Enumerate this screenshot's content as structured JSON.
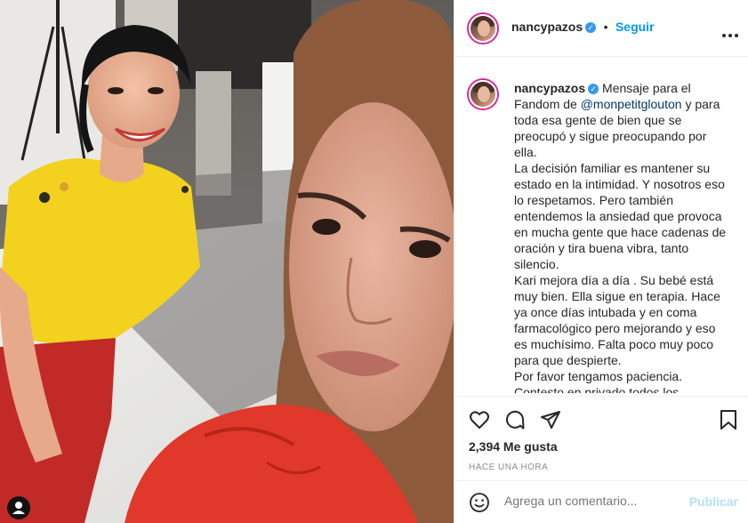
{
  "post": {
    "username": "nancypazos",
    "follow_label": "Seguir",
    "separator": "•",
    "caption": {
      "username": "nancypazos",
      "text_before_mention": "Mensaje para el Fandom de ",
      "mention": "@monpetitglouton",
      "text_after_mention": " y para toda esa gente de bien que se preocupó y sigue preocupando por ella.\nLa decisión familiar es mantener su estado en la intimidad. Y nosotros eso lo respetamos. Pero también entendemos la ansiedad que provoca en mucha gente que hace cadenas de oración y tira buena vibra, tanto silencio.\nKari mejora día a día . Su bebé está muy bien. Ella sigue en terapia. Hace ya once días intubada y en coma farmacológico pero mejorando y eso es muchísimo. Falta poco muy poco para que despierte.\nPor favor tengamos paciencia.\nContesto en privado todos los"
    },
    "likes": "2,394 Me gusta",
    "timestamp": "HACE UNA HORA",
    "comment_placeholder": "Agrega un comentario...",
    "publish_label": "Publicar"
  },
  "icons": {
    "more": "more-options-icon",
    "like": "heart-icon",
    "comment": "comment-icon",
    "share": "share-icon",
    "save": "bookmark-icon",
    "emoji": "emoji-icon",
    "user_tag": "user-tag-icon"
  },
  "colors": {
    "accent": "#0095f6",
    "verified": "#3897f0",
    "publish_disabled": "#b2dffc",
    "yellow_shirt": "#f2d21e",
    "red_jacket": "#e0382a"
  }
}
